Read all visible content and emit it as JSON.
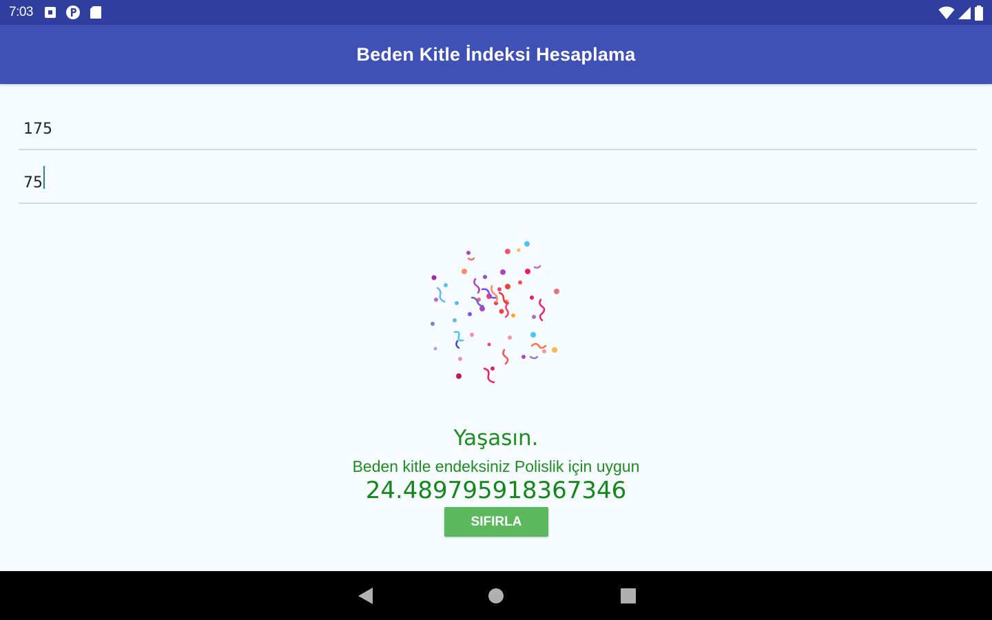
{
  "status_bar": {
    "time": "7:03",
    "left_icons": [
      "notification-square-icon",
      "p-badge-icon",
      "sd-card-icon"
    ],
    "right_icons": [
      "wifi-icon",
      "cell-signal-icon",
      "battery-icon"
    ]
  },
  "app_bar": {
    "title": "Beden Kitle İndeksi Hesaplama"
  },
  "form": {
    "height_value": "175",
    "weight_value": "75"
  },
  "result": {
    "title": "Yaşasın.",
    "message": "Beden kitle endeksiniz Polislik için uygun",
    "bmi_value": "24.489795918367346"
  },
  "actions": {
    "reset_label": "SIFIRLA"
  },
  "nav_bar": {
    "icons": [
      "back-icon",
      "home-icon",
      "recents-icon"
    ]
  },
  "colors": {
    "status_bar": "#303f9f",
    "app_bar": "#3f51b5",
    "result_text": "#1e8e1e",
    "reset_button": "#5cb85c",
    "background": "#f5fbfe"
  }
}
